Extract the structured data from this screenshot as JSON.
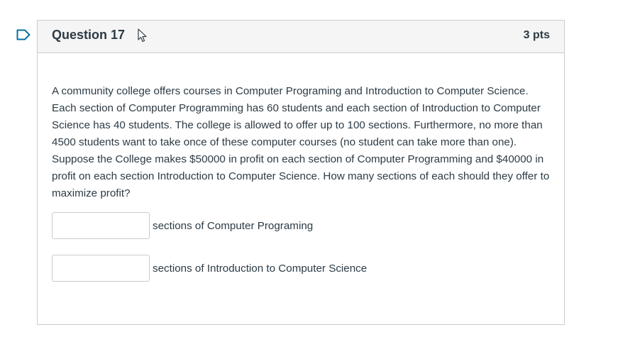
{
  "question": {
    "title": "Question 17",
    "points": "3 pts",
    "text": "A community college offers courses in Computer Programing and Introduction to Computer Science. Each section of Computer Programming has 60 students and each section of Introduction to Computer Science has 40 students. The college is allowed to offer up to 100 sections. Furthermore, no more than 4500 students want to take once of these computer courses (no student can take more than one). Suppose the College makes $50000 in profit on each section of Computer Programming and $40000 in profit on each section Introduction to Computer Science. How many sections of each should they offer to maximize profit?",
    "answers": [
      {
        "value": "",
        "label": "sections of Computer Programing"
      },
      {
        "value": "",
        "label": "sections of Introduction to Computer Science"
      }
    ]
  },
  "colors": {
    "flag_accent": "#0770a3",
    "header_bg": "#f5f5f5",
    "border": "#c7cdd1",
    "text": "#2d3b45"
  },
  "icons": {
    "flag": "flag-question-icon",
    "cursor": "mouse-pointer-icon"
  }
}
